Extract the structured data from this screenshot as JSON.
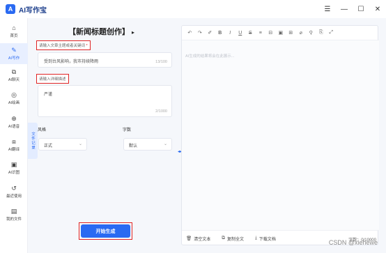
{
  "app": {
    "logo_text": "A",
    "title": "AI写作宝"
  },
  "window_controls": {
    "menu": "☰",
    "minimize": "—",
    "maximize": "☐",
    "close": "✕"
  },
  "sidebar": {
    "items": [
      {
        "icon": "home-icon",
        "glyph": "⌂",
        "label": "首页"
      },
      {
        "icon": "edit-icon",
        "glyph": "✎",
        "label": "AI写作"
      },
      {
        "icon": "chat-icon",
        "glyph": "⧉",
        "label": "AI聊天"
      },
      {
        "icon": "palette-icon",
        "glyph": "◎",
        "label": "AI绘画"
      },
      {
        "icon": "voice-icon",
        "glyph": "⊕",
        "label": "AI语音"
      },
      {
        "icon": "translate-icon",
        "glyph": "⧈",
        "label": "AI翻译"
      },
      {
        "icon": "image-icon",
        "glyph": "▣",
        "label": "AI识图"
      },
      {
        "icon": "history-icon",
        "glyph": "↺",
        "label": "最近使用"
      },
      {
        "icon": "document-icon",
        "glyph": "▤",
        "label": "我的文件"
      }
    ],
    "active_index": 1
  },
  "form": {
    "title": "【新闻标题创作】",
    "title_arrow": "▸",
    "topic_label": "请输入文章主题或者关键词",
    "topic_required": "*",
    "topic_value": "受到台风影响，我市持续降雨",
    "topic_count": "13/100",
    "desc_label": "请输入详细描述",
    "desc_value": "严谨",
    "desc_count": "2/1000",
    "style_label": "风格",
    "style_value": "正式",
    "length_label": "字数",
    "length_value": "默认",
    "side_tab": "文件记录",
    "generate_button": "开始生成"
  },
  "editor": {
    "toolbar": [
      {
        "icon": "undo-icon",
        "glyph": "↶"
      },
      {
        "icon": "redo-icon",
        "glyph": "↷"
      },
      {
        "icon": "format-painter-icon",
        "glyph": "✐"
      },
      {
        "icon": "bold-icon",
        "glyph": "B"
      },
      {
        "icon": "italic-icon",
        "glyph": "I"
      },
      {
        "icon": "underline-icon",
        "glyph": "U"
      },
      {
        "icon": "strikethrough-icon",
        "glyph": "S"
      },
      {
        "icon": "heading-icon",
        "glyph": "≡"
      },
      {
        "icon": "divider-icon",
        "glyph": "⊟"
      },
      {
        "icon": "image-icon",
        "glyph": "▣"
      },
      {
        "icon": "table-icon",
        "glyph": "⊞"
      },
      {
        "icon": "brush-icon",
        "glyph": "⌀"
      },
      {
        "icon": "link-icon",
        "glyph": "⚲"
      },
      {
        "icon": "attachment-icon",
        "glyph": "⎘"
      },
      {
        "icon": "fullscreen-icon",
        "glyph": "⤢"
      }
    ],
    "placeholder": "AI生成的结果将会在此展示...",
    "clear_label": "清空文本",
    "copy_label": "复制全文",
    "download_label": "下载文档",
    "word_count": "字数：0/10000"
  },
  "watermark": "CSDN @xiehewe"
}
